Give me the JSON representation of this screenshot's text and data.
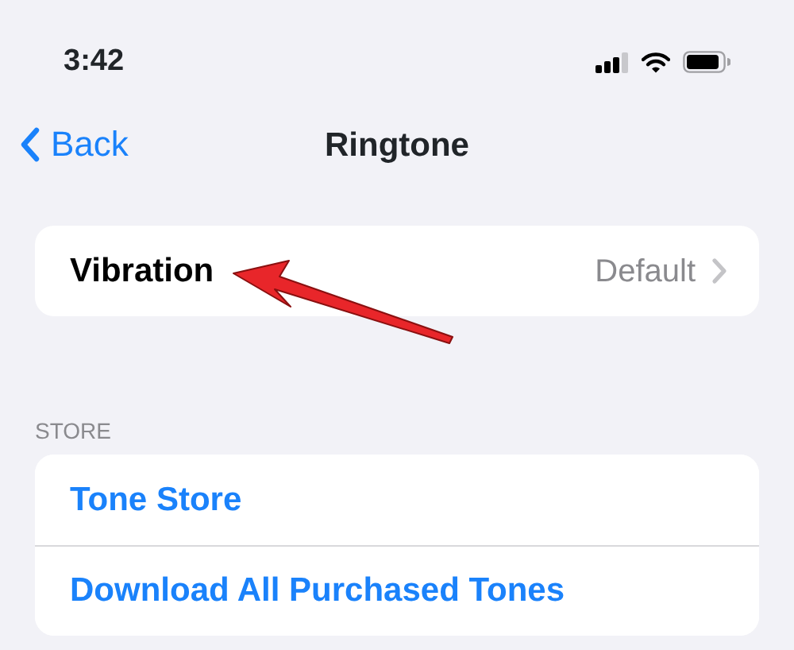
{
  "status_bar": {
    "time": "3:42"
  },
  "nav": {
    "back": "Back",
    "title": "Ringtone"
  },
  "groups": [
    {
      "rows": [
        {
          "label": "Vibration",
          "value": "Default",
          "kind": "detail"
        }
      ]
    },
    {
      "header": "STORE",
      "rows": [
        {
          "label": "Tone Store",
          "kind": "link"
        },
        {
          "label": "Download All Purchased Tones",
          "kind": "link"
        }
      ]
    }
  ]
}
